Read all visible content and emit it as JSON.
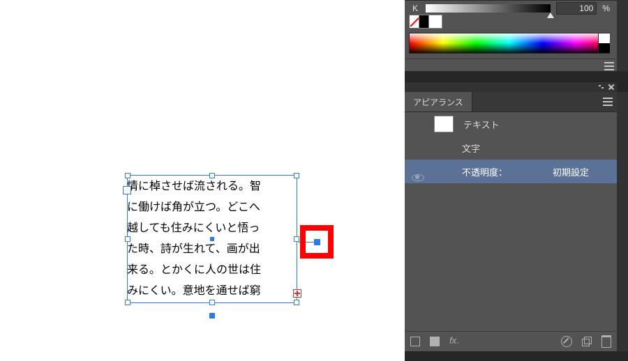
{
  "text_object": {
    "lines": [
      "情に棹させば流される。智",
      "に働けば角が立つ。どこへ",
      "越しても住みにくいと悟っ",
      "た時、詩が生れて、画が出",
      "来る。とかくに人の世は住",
      "みにくい。意地を通せば窮"
    ]
  },
  "color_panel": {
    "channel_label": "K",
    "value": "100",
    "unit": "%"
  },
  "appearance_panel": {
    "tab_title": "アピアランス",
    "rows": {
      "target_label": "テキスト",
      "characters_label": "文字",
      "opacity_label": "不透明度：",
      "opacity_value": "初期設定"
    }
  }
}
